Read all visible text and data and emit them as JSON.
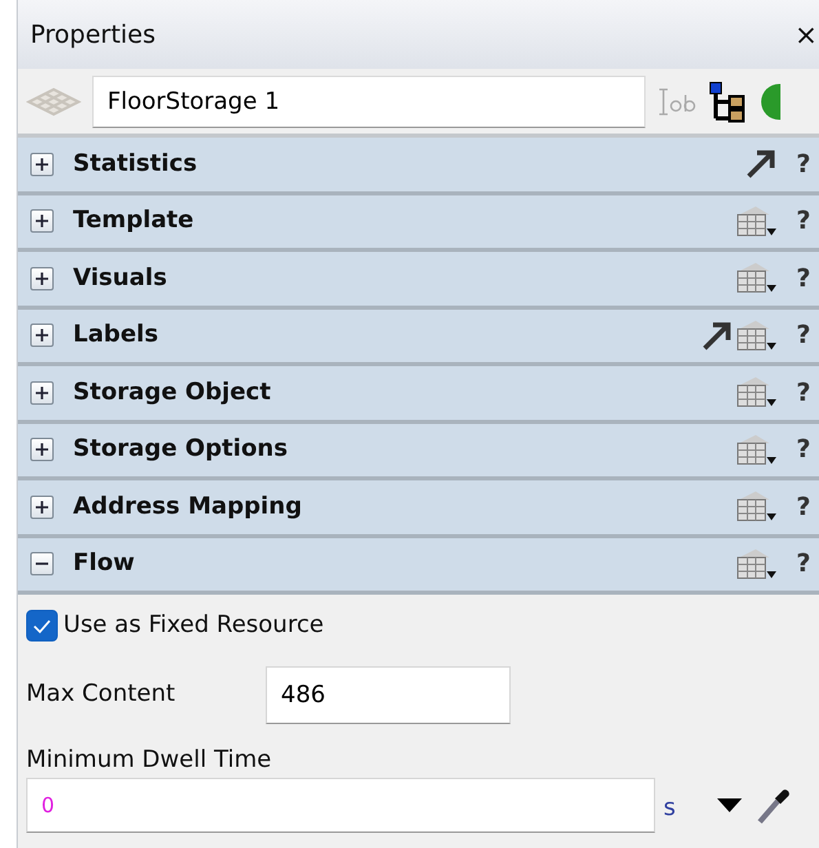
{
  "window": {
    "title": "Properties",
    "close": "×"
  },
  "object_name": {
    "value": "FloorStorage 1"
  },
  "sections": [
    {
      "label": "Statistics",
      "expanded": false,
      "kind": "link",
      "help": "?"
    },
    {
      "label": "Template",
      "expanded": false,
      "kind": "table",
      "help": "?"
    },
    {
      "label": "Visuals",
      "expanded": false,
      "kind": "table",
      "help": "?"
    },
    {
      "label": "Labels",
      "expanded": false,
      "kind": "link-table",
      "help": "?"
    },
    {
      "label": "Storage Object",
      "expanded": false,
      "kind": "table",
      "help": "?"
    },
    {
      "label": "Storage Options",
      "expanded": false,
      "kind": "table",
      "help": "?"
    },
    {
      "label": "Address Mapping",
      "expanded": false,
      "kind": "table",
      "help": "?"
    },
    {
      "label": "Flow",
      "expanded": true,
      "kind": "table",
      "help": "?"
    }
  ],
  "flow": {
    "fixed_resource": {
      "label": "Use as Fixed Resource",
      "checked": true
    },
    "max_content": {
      "label": "Max Content",
      "value": "486"
    },
    "min_dwell_time": {
      "label": "Minimum Dwell Time",
      "value": "0",
      "unit": "s"
    }
  }
}
